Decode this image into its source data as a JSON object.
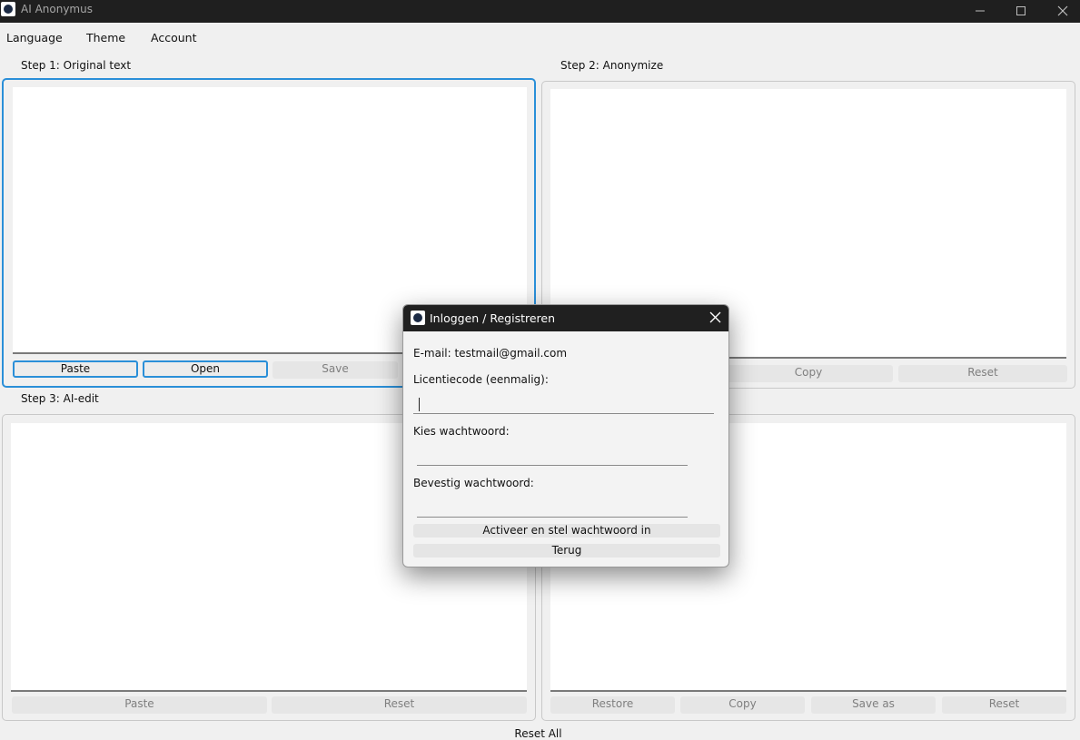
{
  "window": {
    "title": "AI Anonymus",
    "icon": "app-logo-icon"
  },
  "menu": {
    "language": "Language",
    "theme": "Theme",
    "account": "Account"
  },
  "step1": {
    "label": "Step 1: Original text",
    "buttons": {
      "paste": "Paste",
      "open": "Open",
      "save": "Save"
    }
  },
  "step2": {
    "label": "Step 2: Anonymize",
    "buttons": {
      "copy": "Copy",
      "reset": "Reset"
    }
  },
  "step3": {
    "label": "Step 3: AI-edit",
    "buttons": {
      "paste": "Paste",
      "reset": "Reset"
    }
  },
  "step4": {
    "buttons": {
      "restore": "Restore",
      "copy": "Copy",
      "save_as": "Save as",
      "reset": "Reset"
    }
  },
  "reset_all": "Reset All",
  "dialog": {
    "title": "Inloggen / Registreren",
    "email_text": "E-mail: testmail@gmail.com",
    "license_label": "Licentiecode (eenmalig):",
    "password_label": "Kies wachtwoord:",
    "confirm_label": "Bevestig wachtwoord:",
    "activate_button": "Activeer en stel wachtwoord in",
    "back_button": "Terug"
  },
  "colors": {
    "accent": "#2a8fd8",
    "titlebar": "#1f1f1f"
  }
}
